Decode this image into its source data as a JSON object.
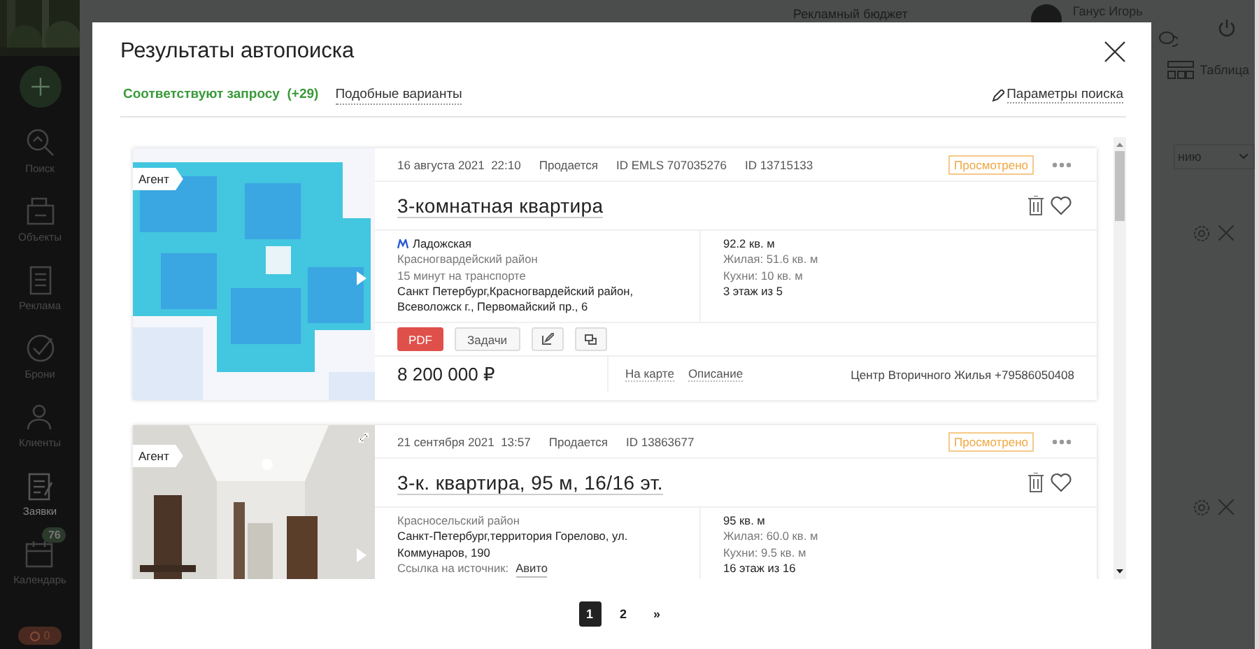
{
  "sidebar": {
    "items": [
      {
        "kind": "search",
        "label": "Поиск"
      },
      {
        "kind": "objects",
        "label": "Объекты"
      },
      {
        "kind": "ads",
        "label": "Реклама"
      },
      {
        "kind": "bookings",
        "label": "Брони"
      },
      {
        "kind": "clients",
        "label": "Клиенты"
      },
      {
        "kind": "requests",
        "label": "Заявки"
      },
      {
        "kind": "calendar",
        "label": "Календарь",
        "badge": "76"
      }
    ],
    "bottom_counter": "0"
  },
  "topbar": {
    "budget_label": "Рекламный бюджет",
    "user_name": "Ганус Игорь"
  },
  "side_panel": {
    "view_label": "Таблица",
    "dropdown_value": "нию"
  },
  "modal": {
    "title": "Результаты автопоиска",
    "tabs": [
      {
        "label": "Соответствуют запросу",
        "count": "(+29)",
        "selected": true
      },
      {
        "label": "Подобные варианты",
        "selected": false
      }
    ],
    "search_params_link": "Параметры поиска",
    "listings": [
      {
        "tag": "Агент",
        "date": "16 августа 2021",
        "time": "22:10",
        "status": "Продается",
        "ids": [
          "ID EMLS 707035276",
          "ID 13715133"
        ],
        "viewed_badge": "Просмотрено",
        "title": "3-комнатная квартира",
        "location": [
          {
            "kind": "metro",
            "text": "Ладожская"
          },
          {
            "kind": "muted",
            "text": "Красногвардейский район"
          },
          {
            "kind": "muted",
            "text": "15 минут на транспорте"
          },
          {
            "kind": "main",
            "text": "Санкт Петербург,Красногвардейский район, Всеволожск г., Первомайский пр., 6"
          }
        ],
        "specs": [
          {
            "kind": "main",
            "text": "92.2 кв. м"
          },
          {
            "kind": "muted",
            "text": "Жилая: 51.6 кв. м"
          },
          {
            "kind": "muted",
            "text": "Кухни: 10 кв. м"
          },
          {
            "kind": "main",
            "text": "3 этаж из 5"
          }
        ],
        "pdf_label": "PDF",
        "tasks_label": "Задачи",
        "price": "8 200 000 ₽",
        "links": [
          "На карте",
          "Описание"
        ],
        "agency": "Центр Вторичного Жилья +79586050408"
      },
      {
        "tag": "Агент",
        "date": "21 сентября 2021",
        "time": "13:57",
        "status": "Продается",
        "ids": [
          "ID 13863677"
        ],
        "viewed_badge": "Просмотрено",
        "title": "3-к. квартира, 95 м, 16/16 эт.",
        "location": [
          {
            "kind": "muted",
            "text": "Красносельский район"
          },
          {
            "kind": "main",
            "text": "Санкт-Петербург,территория Горелово, ул. Коммунаров, 190"
          },
          {
            "kind": "source",
            "text": "Ссылка на источник:",
            "link": "Авито"
          }
        ],
        "specs": [
          {
            "kind": "main",
            "text": "95 кв. м"
          },
          {
            "kind": "muted",
            "text": "Жилая: 60.0 кв. м"
          },
          {
            "kind": "muted",
            "text": "Кухни: 9.5 кв. м"
          },
          {
            "kind": "main",
            "text": "16 этаж из 16"
          }
        ]
      }
    ],
    "pagination": [
      {
        "label": "1",
        "selected": true
      },
      {
        "label": "2",
        "selected": false
      },
      {
        "label": "»",
        "selected": false
      }
    ]
  }
}
